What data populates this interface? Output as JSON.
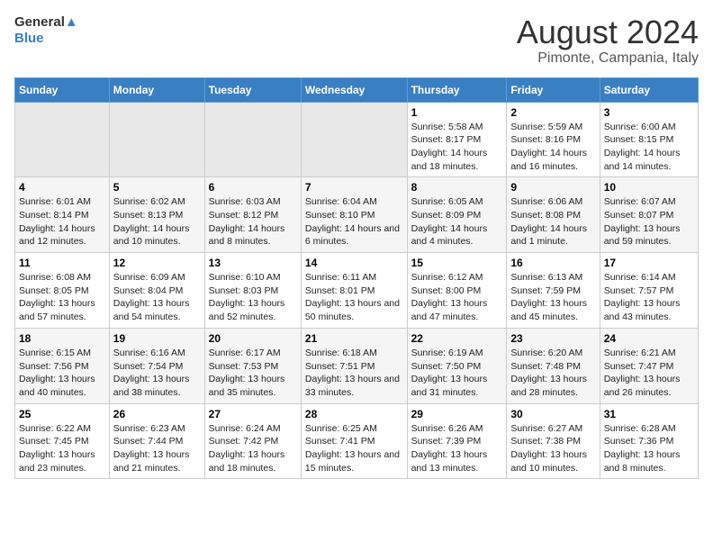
{
  "logo": {
    "general": "General",
    "blue": "Blue"
  },
  "title": "August 2024",
  "subtitle": "Pimonte, Campania, Italy",
  "weekdays": [
    "Sunday",
    "Monday",
    "Tuesday",
    "Wednesday",
    "Thursday",
    "Friday",
    "Saturday"
  ],
  "weeks": [
    [
      {
        "day": "",
        "empty": true
      },
      {
        "day": "",
        "empty": true
      },
      {
        "day": "",
        "empty": true
      },
      {
        "day": "",
        "empty": true
      },
      {
        "day": "1",
        "sunrise": "5:58 AM",
        "sunset": "8:17 PM",
        "daylight": "14 hours and 18 minutes."
      },
      {
        "day": "2",
        "sunrise": "5:59 AM",
        "sunset": "8:16 PM",
        "daylight": "14 hours and 16 minutes."
      },
      {
        "day": "3",
        "sunrise": "6:00 AM",
        "sunset": "8:15 PM",
        "daylight": "14 hours and 14 minutes."
      }
    ],
    [
      {
        "day": "4",
        "sunrise": "6:01 AM",
        "sunset": "8:14 PM",
        "daylight": "14 hours and 12 minutes."
      },
      {
        "day": "5",
        "sunrise": "6:02 AM",
        "sunset": "8:13 PM",
        "daylight": "14 hours and 10 minutes."
      },
      {
        "day": "6",
        "sunrise": "6:03 AM",
        "sunset": "8:12 PM",
        "daylight": "14 hours and 8 minutes."
      },
      {
        "day": "7",
        "sunrise": "6:04 AM",
        "sunset": "8:10 PM",
        "daylight": "14 hours and 6 minutes."
      },
      {
        "day": "8",
        "sunrise": "6:05 AM",
        "sunset": "8:09 PM",
        "daylight": "14 hours and 4 minutes."
      },
      {
        "day": "9",
        "sunrise": "6:06 AM",
        "sunset": "8:08 PM",
        "daylight": "14 hours and 1 minute."
      },
      {
        "day": "10",
        "sunrise": "6:07 AM",
        "sunset": "8:07 PM",
        "daylight": "13 hours and 59 minutes."
      }
    ],
    [
      {
        "day": "11",
        "sunrise": "6:08 AM",
        "sunset": "8:05 PM",
        "daylight": "13 hours and 57 minutes."
      },
      {
        "day": "12",
        "sunrise": "6:09 AM",
        "sunset": "8:04 PM",
        "daylight": "13 hours and 54 minutes."
      },
      {
        "day": "13",
        "sunrise": "6:10 AM",
        "sunset": "8:03 PM",
        "daylight": "13 hours and 52 minutes."
      },
      {
        "day": "14",
        "sunrise": "6:11 AM",
        "sunset": "8:01 PM",
        "daylight": "13 hours and 50 minutes."
      },
      {
        "day": "15",
        "sunrise": "6:12 AM",
        "sunset": "8:00 PM",
        "daylight": "13 hours and 47 minutes."
      },
      {
        "day": "16",
        "sunrise": "6:13 AM",
        "sunset": "7:59 PM",
        "daylight": "13 hours and 45 minutes."
      },
      {
        "day": "17",
        "sunrise": "6:14 AM",
        "sunset": "7:57 PM",
        "daylight": "13 hours and 43 minutes."
      }
    ],
    [
      {
        "day": "18",
        "sunrise": "6:15 AM",
        "sunset": "7:56 PM",
        "daylight": "13 hours and 40 minutes."
      },
      {
        "day": "19",
        "sunrise": "6:16 AM",
        "sunset": "7:54 PM",
        "daylight": "13 hours and 38 minutes."
      },
      {
        "day": "20",
        "sunrise": "6:17 AM",
        "sunset": "7:53 PM",
        "daylight": "13 hours and 35 minutes."
      },
      {
        "day": "21",
        "sunrise": "6:18 AM",
        "sunset": "7:51 PM",
        "daylight": "13 hours and 33 minutes."
      },
      {
        "day": "22",
        "sunrise": "6:19 AM",
        "sunset": "7:50 PM",
        "daylight": "13 hours and 31 minutes."
      },
      {
        "day": "23",
        "sunrise": "6:20 AM",
        "sunset": "7:48 PM",
        "daylight": "13 hours and 28 minutes."
      },
      {
        "day": "24",
        "sunrise": "6:21 AM",
        "sunset": "7:47 PM",
        "daylight": "13 hours and 26 minutes."
      }
    ],
    [
      {
        "day": "25",
        "sunrise": "6:22 AM",
        "sunset": "7:45 PM",
        "daylight": "13 hours and 23 minutes."
      },
      {
        "day": "26",
        "sunrise": "6:23 AM",
        "sunset": "7:44 PM",
        "daylight": "13 hours and 21 minutes."
      },
      {
        "day": "27",
        "sunrise": "6:24 AM",
        "sunset": "7:42 PM",
        "daylight": "13 hours and 18 minutes."
      },
      {
        "day": "28",
        "sunrise": "6:25 AM",
        "sunset": "7:41 PM",
        "daylight": "13 hours and 15 minutes."
      },
      {
        "day": "29",
        "sunrise": "6:26 AM",
        "sunset": "7:39 PM",
        "daylight": "13 hours and 13 minutes."
      },
      {
        "day": "30",
        "sunrise": "6:27 AM",
        "sunset": "7:38 PM",
        "daylight": "13 hours and 10 minutes."
      },
      {
        "day": "31",
        "sunrise": "6:28 AM",
        "sunset": "7:36 PM",
        "daylight": "13 hours and 8 minutes."
      }
    ]
  ]
}
